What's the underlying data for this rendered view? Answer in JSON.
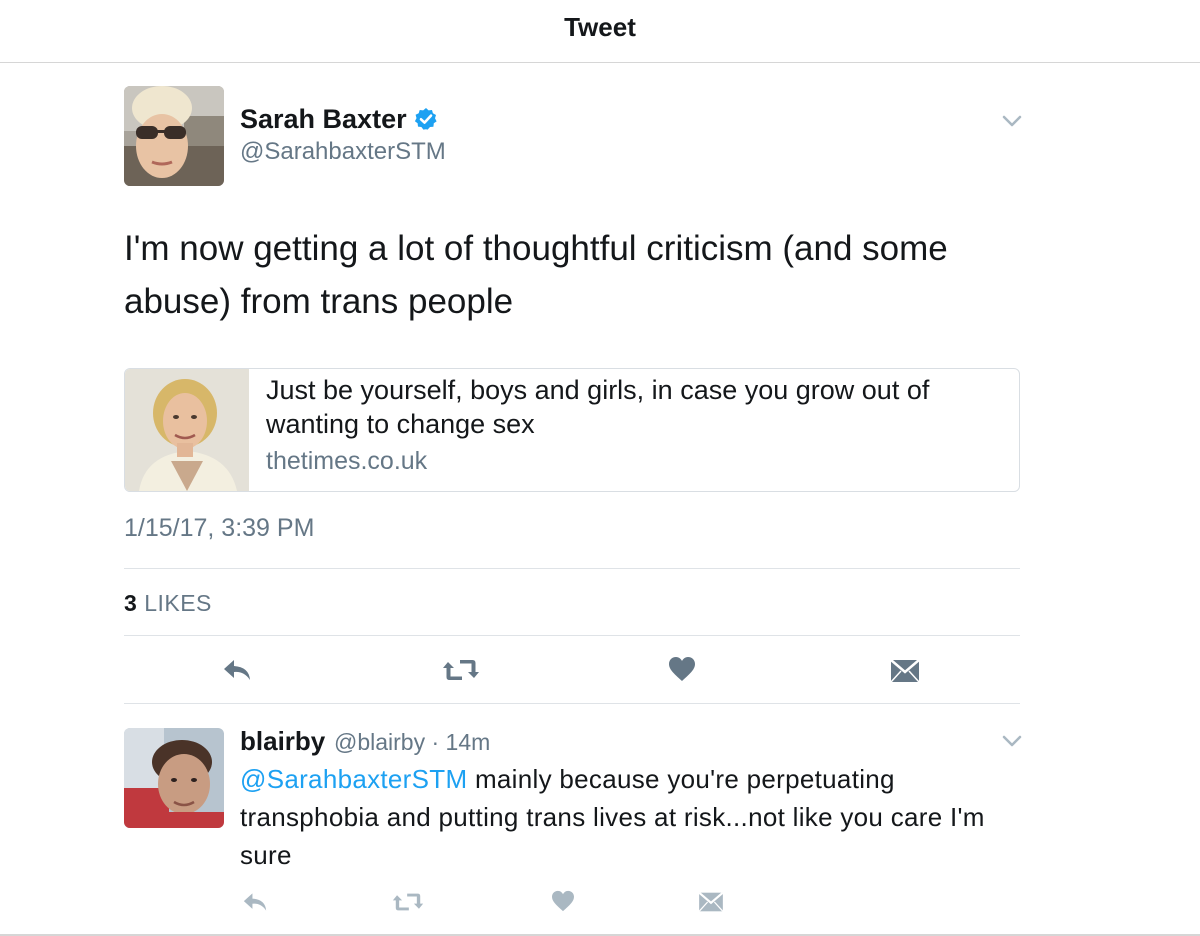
{
  "header": {
    "title": "Tweet"
  },
  "tweet": {
    "author_name": "Sarah Baxter",
    "author_handle": "@SarahbaxterSTM",
    "text": "I'm now getting a lot of thoughtful criticism (and some abuse) from trans people",
    "card": {
      "title": "Just be yourself, boys and girls, in case you grow out of wanting to change sex",
      "domain": "thetimes.co.uk"
    },
    "timestamp": "1/15/17, 3:39 PM",
    "likes_count": "3",
    "likes_label": "LIKES"
  },
  "reply": {
    "author_name": "blairby",
    "author_handle": "@blairby",
    "time": "· 14m",
    "mention": "@SarahbaxterSTM",
    "text": " mainly because you're perpetuating transphobia and putting trans lives at risk...not like you care I'm sure"
  },
  "colors": {
    "accent": "#1da1f2",
    "icon_gray": "#657786",
    "icon_light": "#aab8c2",
    "text": "#14171a"
  },
  "icons": [
    "chevron-down-icon",
    "verified-badge-icon",
    "reply-icon",
    "retweet-icon",
    "heart-icon",
    "message-icon"
  ]
}
